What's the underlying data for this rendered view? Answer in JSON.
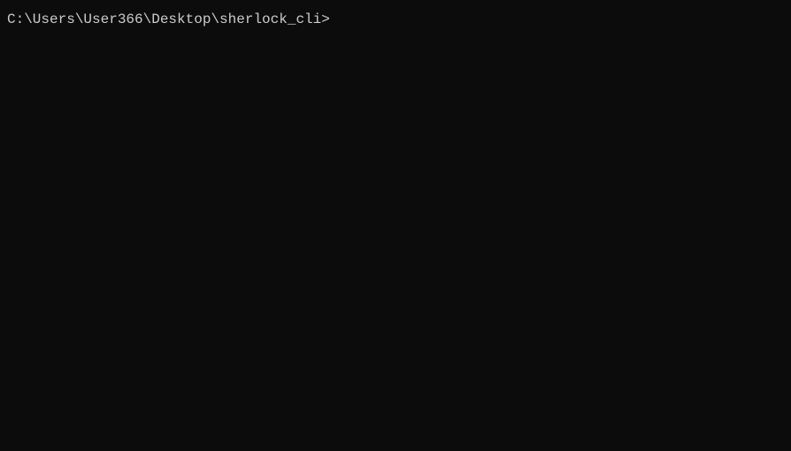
{
  "terminal": {
    "prompt": "C:\\Users\\User366\\Desktop\\sherlock_cli>",
    "command": ""
  }
}
